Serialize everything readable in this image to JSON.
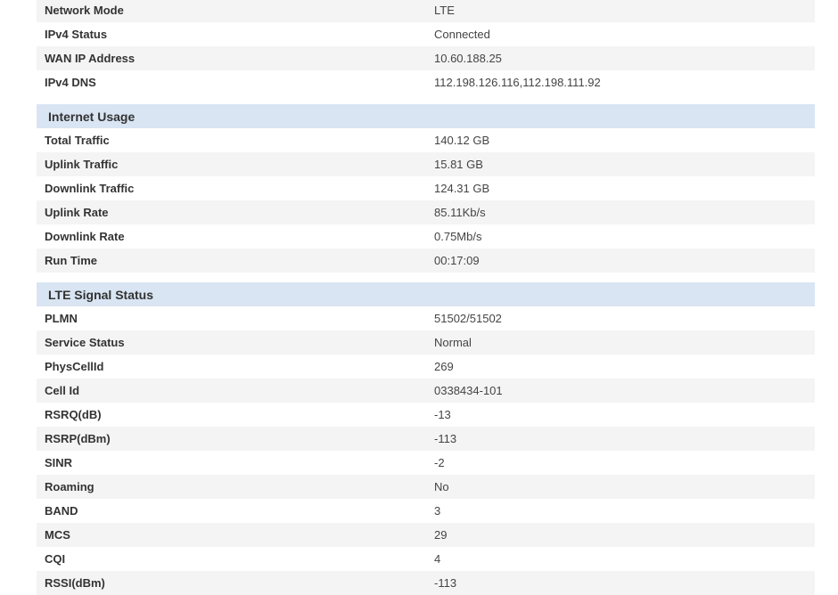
{
  "network": {
    "rows": [
      {
        "label": "Network Mode",
        "value": "LTE"
      },
      {
        "label": "IPv4 Status",
        "value": "Connected"
      },
      {
        "label": "WAN IP Address",
        "value": "10.60.188.25"
      },
      {
        "label": "IPv4 DNS",
        "value": "112.198.126.116,112.198.111.92"
      }
    ]
  },
  "internet_usage": {
    "title": "Internet Usage",
    "rows": [
      {
        "label": "Total Traffic",
        "value": "140.12 GB"
      },
      {
        "label": "Uplink Traffic",
        "value": "15.81 GB"
      },
      {
        "label": "Downlink Traffic",
        "value": "124.31 GB"
      },
      {
        "label": "Uplink Rate",
        "value": "85.11Kb/s"
      },
      {
        "label": "Downlink Rate",
        "value": "0.75Mb/s"
      },
      {
        "label": "Run Time",
        "value": "00:17:09"
      }
    ]
  },
  "lte_signal": {
    "title": "LTE Signal Status",
    "rows": [
      {
        "label": "PLMN",
        "value": "51502/51502"
      },
      {
        "label": "Service Status",
        "value": "Normal"
      },
      {
        "label": "PhysCellId",
        "value": "269"
      },
      {
        "label": "Cell Id",
        "value": "0338434-101"
      },
      {
        "label": "RSRQ(dB)",
        "value": "-13"
      },
      {
        "label": "RSRP(dBm)",
        "value": "-113"
      },
      {
        "label": "SINR",
        "value": "-2"
      },
      {
        "label": "Roaming",
        "value": "No"
      },
      {
        "label": "BAND",
        "value": "3"
      },
      {
        "label": "MCS",
        "value": "29"
      },
      {
        "label": "CQI",
        "value": "4"
      },
      {
        "label": "RSSI(dBm)",
        "value": "-113"
      }
    ]
  },
  "colors": {
    "section_header_bg": "#d9e5f3",
    "alt_row_bg": "#f4f4f4"
  }
}
